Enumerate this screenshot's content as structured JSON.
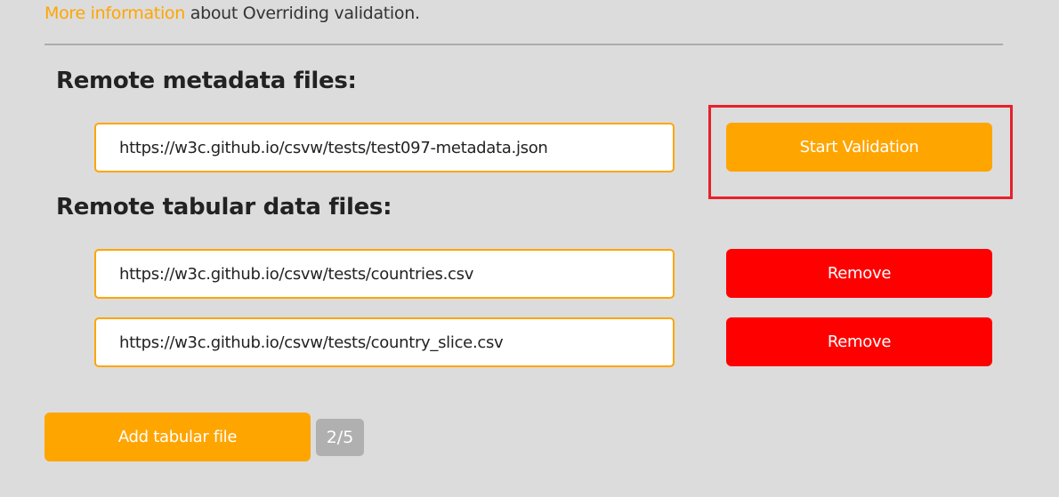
{
  "info": {
    "link": "More information",
    "text": " about Overriding validation."
  },
  "metadata": {
    "heading": "Remote metadata files:",
    "url": "https://w3c.github.io/csvw/tests/test097-metadata.json",
    "start_label": "Start Validation"
  },
  "tabular": {
    "heading": "Remote tabular data files:",
    "files": [
      {
        "url": "https://w3c.github.io/csvw/tests/countries.csv",
        "remove_label": "Remove"
      },
      {
        "url": "https://w3c.github.io/csvw/tests/country_slice.csv",
        "remove_label": "Remove"
      }
    ],
    "add_label": "Add tabular file",
    "count": "2/5"
  }
}
